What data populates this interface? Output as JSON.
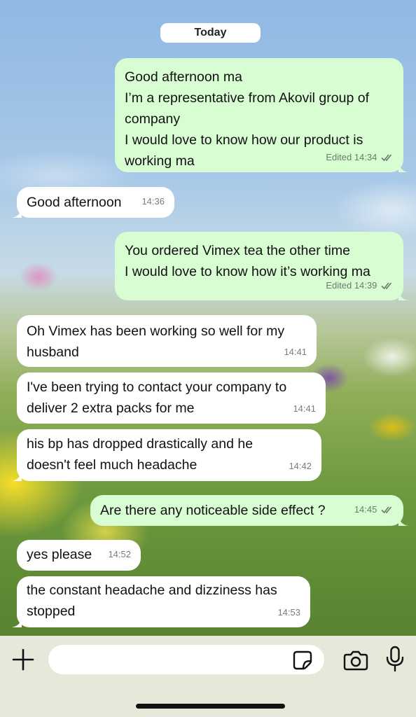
{
  "chat": {
    "date_label": "Today",
    "messages": [
      {
        "direction": "outgoing",
        "lines": [
          "Good afternoon ma",
          "I’m a representative from Akovil group of",
          "company",
          "I would love to know how our product is",
          "working ma"
        ],
        "edited": "Edited",
        "time": "14:34",
        "read": true
      },
      {
        "direction": "incoming",
        "lines": [
          "Good afternoon"
        ],
        "time": "14:36"
      },
      {
        "direction": "outgoing",
        "lines": [
          "You ordered Vimex tea the other time",
          "I would love to know how it’s working  ma"
        ],
        "edited": "Edited",
        "time": "14:39",
        "read": true
      },
      {
        "direction": "incoming",
        "lines": [
          "Oh Vimex has been working so well for my",
          "husband"
        ],
        "time": "14:41"
      },
      {
        "direction": "incoming",
        "lines": [
          "I've been trying to contact your company to",
          "deliver 2 extra packs for me"
        ],
        "time": "14:41"
      },
      {
        "direction": "incoming",
        "lines": [
          "his bp has dropped drastically and he",
          "doesn't feel much headache"
        ],
        "time": "14:42"
      },
      {
        "direction": "outgoing",
        "lines": [
          "Are there any noticeable side effect ?"
        ],
        "time": "14:45",
        "read": true
      },
      {
        "direction": "incoming",
        "lines": [
          "yes please"
        ],
        "time": "14:52"
      },
      {
        "direction": "incoming",
        "lines": [
          "the constant headache and dizziness has",
          "stopped"
        ],
        "time": "14:53"
      }
    ]
  },
  "composer": {
    "input_value": "",
    "icons": [
      "plus-icon",
      "sticker-icon",
      "camera-icon",
      "microphone-icon"
    ]
  },
  "colors": {
    "outgoing_bubble": "#d9fdd3",
    "incoming_bubble": "#ffffff",
    "read_ticks": "#6b7b6b"
  }
}
